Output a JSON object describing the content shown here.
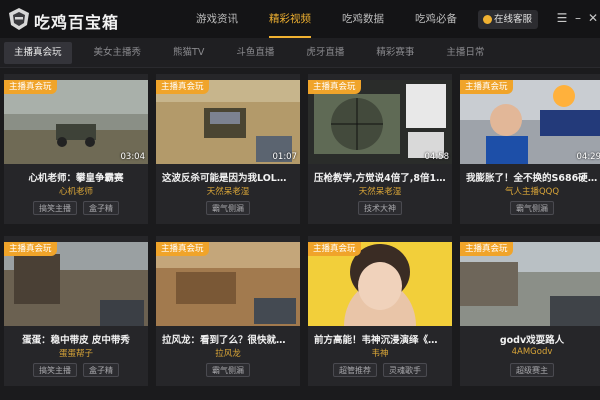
{
  "app": {
    "title": "吃鸡百宝箱"
  },
  "nav": {
    "items": [
      {
        "label": "游戏资讯",
        "active": false
      },
      {
        "label": "精彩视频",
        "active": true
      },
      {
        "label": "吃鸡数据",
        "active": false
      },
      {
        "label": "吃鸡必备",
        "active": false
      }
    ],
    "service_label": "在线客服",
    "menu_icon": "☰",
    "minimize_icon": "–",
    "close_icon": "✕"
  },
  "subnav": {
    "items": [
      {
        "label": "主播真会玩",
        "active": true
      },
      {
        "label": "美女主播秀",
        "active": false
      },
      {
        "label": "熊猫TV",
        "active": false
      },
      {
        "label": "斗鱼直播",
        "active": false
      },
      {
        "label": "虎牙直播",
        "active": false
      },
      {
        "label": "精彩赛事",
        "active": false
      },
      {
        "label": "主播日常",
        "active": false
      }
    ]
  },
  "colors": {
    "accent": "#f0b131",
    "badge": "#f0a42a"
  },
  "videos": [
    {
      "badge": "主播真会玩",
      "duration": "03:04",
      "title": "心机老师：攀皇争霸赛",
      "author": "心机老师",
      "tags": [
        "搞笑主播",
        "盒子精"
      ]
    },
    {
      "badge": "主播真会玩",
      "duration": "01:07",
      "title": "这波反杀可能是因为我LOL言僧...",
      "author": "天然呆老湿",
      "tags": [
        "霸气侧漏"
      ]
    },
    {
      "badge": "主播真会玩",
      "duration": "04:58",
      "title": "压枪教学,方觉说4倍了,8倍15...",
      "author": "天然呆老湿",
      "tags": [
        "技术大神"
      ]
    },
    {
      "badge": "主播真会玩",
      "duration": "04:29",
      "title": "我膨胀了！全不换的S686硬去...",
      "author": "气人主播QQQ",
      "tags": [
        "霸气侧漏"
      ]
    },
    {
      "badge": "主播真会玩",
      "duration": "",
      "title": "蛋蛋：稳中带皮 皮中带秀",
      "author": "蛋蛋帮子",
      "tags": [
        "搞笑主播",
        "盒子精"
      ]
    },
    {
      "badge": "主播真会玩",
      "duration": "",
      "title": "拉风龙：看到了么？很快就可重...",
      "author": "拉风龙",
      "tags": [
        "霸气侧漏"
      ]
    },
    {
      "badge": "主播真会玩",
      "duration": "",
      "title": "前方高能！韦神沉浸演绎《燃烧...",
      "author": "韦神",
      "tags": [
        "超管推荐",
        "灵魂歌手"
      ]
    },
    {
      "badge": "主播真会玩",
      "duration": "",
      "title": "godv戏耍路人",
      "author": "4AMGodv",
      "tags": [
        "超级赛主"
      ]
    }
  ]
}
